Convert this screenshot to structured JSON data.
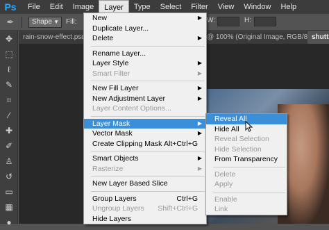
{
  "menubar": {
    "logo": "Ps",
    "items": [
      "File",
      "Edit",
      "Image",
      "Layer",
      "Type",
      "Select",
      "Filter",
      "View",
      "Window",
      "Help"
    ]
  },
  "options": {
    "shape_value": "Shape",
    "fill_label": "Fill:",
    "w_label": "W:",
    "h_label": "H:"
  },
  "tabs": {
    "left": "rain-snow-effect.psd",
    "center": "@ 100% (Original Image, RGB/8)",
    "right": "shutte"
  },
  "layer_menu": {
    "items": [
      {
        "label": "New",
        "arrow": true
      },
      {
        "label": "Duplicate Layer..."
      },
      {
        "label": "Delete",
        "arrow": true
      },
      {
        "sep": true
      },
      {
        "label": "Rename Layer..."
      },
      {
        "label": "Layer Style",
        "arrow": true
      },
      {
        "label": "Smart Filter",
        "disabled": true,
        "arrow": true
      },
      {
        "sep": true
      },
      {
        "label": "New Fill Layer",
        "arrow": true
      },
      {
        "label": "New Adjustment Layer",
        "arrow": true
      },
      {
        "label": "Layer Content Options...",
        "disabled": true
      },
      {
        "sep": true
      },
      {
        "label": "Layer Mask",
        "arrow": true,
        "highlighted": true
      },
      {
        "label": "Vector Mask",
        "arrow": true
      },
      {
        "label": "Create Clipping Mask",
        "shortcut": "Alt+Ctrl+G"
      },
      {
        "sep": true
      },
      {
        "label": "Smart Objects",
        "arrow": true
      },
      {
        "label": "Rasterize",
        "disabled": true,
        "arrow": true
      },
      {
        "sep": true
      },
      {
        "label": "New Layer Based Slice"
      },
      {
        "sep": true
      },
      {
        "label": "Group Layers",
        "shortcut": "Ctrl+G"
      },
      {
        "label": "Ungroup Layers",
        "shortcut": "Shift+Ctrl+G",
        "disabled": true
      },
      {
        "label": "Hide Layers"
      }
    ]
  },
  "mask_submenu": {
    "items": [
      {
        "label": "Reveal All",
        "highlighted": true
      },
      {
        "label": "Hide All"
      },
      {
        "label": "Reveal Selection",
        "disabled": true
      },
      {
        "label": "Hide Selection",
        "disabled": true
      },
      {
        "label": "From Transparency"
      },
      {
        "sep": true
      },
      {
        "label": "Delete",
        "disabled": true
      },
      {
        "label": "Apply",
        "disabled": true
      },
      {
        "sep": true
      },
      {
        "label": "Enable",
        "disabled": true
      },
      {
        "label": "Link",
        "disabled": true
      }
    ]
  },
  "tools": [
    "move-icon",
    "marquee-icon",
    "lasso-icon",
    "quick-select-icon",
    "crop-icon",
    "eyedropper-icon",
    "healing-icon",
    "brush-icon",
    "stamp-icon",
    "history-brush-icon",
    "eraser-icon",
    "gradient-icon",
    "blur-icon"
  ],
  "colors": {
    "menu_highlight": "#3b8fd9",
    "ps_blue": "#31a8ff"
  }
}
